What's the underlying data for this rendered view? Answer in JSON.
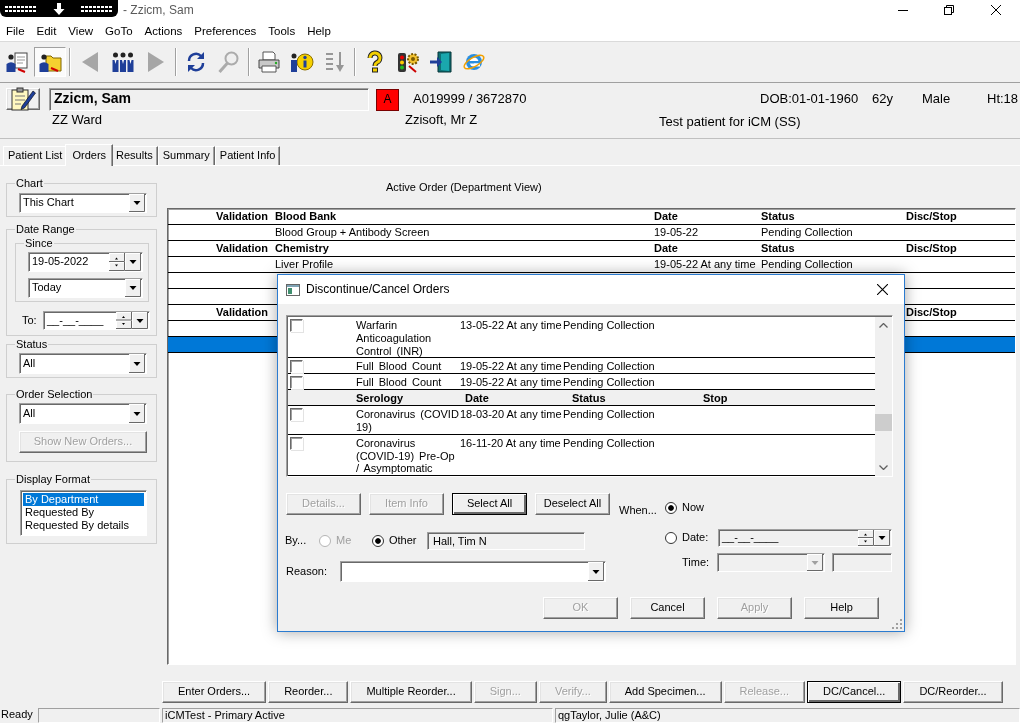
{
  "window": {
    "title": "- Zzicm, Sam"
  },
  "menu": [
    "File",
    "Edit",
    "View",
    "GoTo",
    "Actions",
    "Preferences",
    "Tools",
    "Help"
  ],
  "toolbar": [
    [
      {
        "pressed": false,
        "disabled": false
      },
      {
        "pressed": true,
        "disabled": false
      }
    ],
    [
      {
        "pressed": false,
        "disabled": true
      },
      {
        "pressed": false,
        "disabled": false
      },
      {
        "pressed": false,
        "disabled": true
      }
    ],
    [
      {
        "pressed": false,
        "disabled": false
      },
      {
        "pressed": false,
        "disabled": true
      }
    ],
    [
      {
        "pressed": false,
        "disabled": false
      },
      {
        "pressed": false,
        "disabled": false
      },
      {
        "pressed": false,
        "disabled": true
      }
    ],
    [
      {
        "pressed": false,
        "disabled": false
      },
      {
        "pressed": false,
        "disabled": false
      },
      {
        "pressed": false,
        "disabled": false
      },
      {
        "pressed": false,
        "disabled": false
      }
    ]
  ],
  "patient": {
    "name": "Zzicm, Sam",
    "alert": "A",
    "numbers": "A019999 / 3672870",
    "dob": "DOB:01-01-1960",
    "age": "62y",
    "sex": "Male",
    "height": "Ht:18",
    "ward": "ZZ Ward",
    "consultant": "Zzisoft, Mr Z",
    "note": "Test patient for iCM (SS)"
  },
  "tabs": [
    {
      "label": "Patient List",
      "selected": false
    },
    {
      "label": "Orders",
      "selected": true
    },
    {
      "label": "Results",
      "selected": false
    },
    {
      "label": "Summary",
      "selected": false
    },
    {
      "label": "Patient Info",
      "selected": false
    }
  ],
  "filters": {
    "chart": {
      "legend": "Chart",
      "value": "This Chart"
    },
    "date_range": {
      "legend": "Date Range",
      "since": {
        "legend": "Since",
        "date": "19-05-2022",
        "preset": "Today"
      },
      "to_label": "To:",
      "to_date": "__-__-____"
    },
    "status": {
      "legend": "Status",
      "value": "All"
    },
    "order_selection": {
      "legend": "Order Selection",
      "value": "All",
      "button": {
        "label": "Show New Orders...",
        "disabled": true
      }
    },
    "display_format": {
      "legend": "Display Format",
      "options": [
        {
          "label": "By Department",
          "selected": true
        },
        {
          "label": "Requested By",
          "selected": false
        },
        {
          "label": "Requested By details",
          "selected": false
        }
      ]
    }
  },
  "orders": {
    "title": "Active Order (Department View)",
    "rows": [
      {
        "kind": "header",
        "validation": "Validation",
        "department": "Blood Bank",
        "date": "Date",
        "status": "Status",
        "stop": "Disc/Stop"
      },
      {
        "kind": "order",
        "name": "Blood Group + Antibody Screen",
        "date": "19-05-22",
        "status": "Pending Collection",
        "selected": false
      },
      {
        "kind": "header",
        "validation": "Validation",
        "department": "Chemistry",
        "date": "Date",
        "status": "Status",
        "stop": "Disc/Stop"
      },
      {
        "kind": "order",
        "name": "Liver Profile",
        "date": "19-05-22 At any time",
        "status": "Pending Collection",
        "selected": false
      },
      {
        "kind": "order",
        "selected": false
      },
      {
        "kind": "order",
        "selected": false
      },
      {
        "kind": "header",
        "validation": "Validation",
        "stop": "Disc/Stop"
      },
      {
        "kind": "order",
        "selected": false
      },
      {
        "kind": "order",
        "selected": true
      }
    ]
  },
  "actions": [
    {
      "label": "Enter Orders...",
      "disabled": false,
      "default": false
    },
    {
      "label": "Reorder...",
      "disabled": false,
      "default": false
    },
    {
      "label": "Multiple Reorder...",
      "disabled": false,
      "default": false
    },
    {
      "label": "Sign...",
      "disabled": true,
      "default": false
    },
    {
      "label": "Verify...",
      "disabled": true,
      "default": false
    },
    {
      "label": "Add Specimen...",
      "disabled": false,
      "default": false
    },
    {
      "label": "Release...",
      "disabled": true,
      "default": false
    },
    {
      "label": "DC/Cancel...",
      "disabled": false,
      "default": true
    },
    {
      "label": "DC/Reorder...",
      "disabled": false,
      "default": false
    }
  ],
  "dialog": {
    "title": "Discontinue/Cancel Orders",
    "rows": [
      {
        "kind": "order",
        "checked": false,
        "name": "Warfarin Anticoagulation Control (INR)",
        "date": "13-05-22 At any time",
        "status": "Pending Collection"
      },
      {
        "kind": "order",
        "checked": false,
        "name": "Full Blood Count",
        "date": "19-05-22 At any time",
        "status": "Pending Collection"
      },
      {
        "kind": "order",
        "checked": false,
        "name": "Full Blood Count",
        "date": "19-05-22 At any time",
        "status": "Pending Collection"
      },
      {
        "kind": "header",
        "department": "Serology",
        "date": "Date",
        "status": "Status",
        "stop": "Stop"
      },
      {
        "kind": "order",
        "checked": false,
        "name": "Coronavirus (COVID 19)",
        "date": "18-03-20 At any time",
        "status": "Pending Collection"
      },
      {
        "kind": "order",
        "checked": false,
        "name": "Coronavirus (COVID-19) Pre-Op / Asymptomatic",
        "date": "16-11-20 At any time",
        "status": "Pending Collection"
      }
    ],
    "buttons": [
      {
        "label": "Details...",
        "disabled": true,
        "default": false
      },
      {
        "label": "Item Info",
        "disabled": true,
        "default": false
      },
      {
        "label": "Select All",
        "disabled": false,
        "default": true
      },
      {
        "label": "Deselect All",
        "disabled": false,
        "default": false
      }
    ],
    "by": {
      "label": "By...",
      "options": [
        {
          "label": "Me",
          "selected": false,
          "disabled": true
        },
        {
          "label": "Other",
          "selected": true,
          "disabled": false
        }
      ],
      "value": "Hall, Tim N"
    },
    "reason": {
      "label": "Reason:"
    },
    "when": {
      "label": "When...",
      "options": [
        {
          "label": "Now",
          "selected": true
        },
        {
          "label": "Date:",
          "selected": false
        }
      ],
      "date": "__-__-____",
      "time_label": "Time:",
      "time_disabled": true
    },
    "actions": [
      {
        "label": "OK",
        "disabled": true,
        "default": false
      },
      {
        "label": "Cancel",
        "disabled": false,
        "default": false
      },
      {
        "label": "Apply",
        "disabled": true,
        "default": false
      },
      {
        "label": "Help",
        "disabled": false,
        "default": false
      }
    ]
  },
  "status_bar": {
    "message": "Ready",
    "environment": "iCMTest - Primary Active",
    "user": "qgTaylor, Julie (A&C)"
  }
}
